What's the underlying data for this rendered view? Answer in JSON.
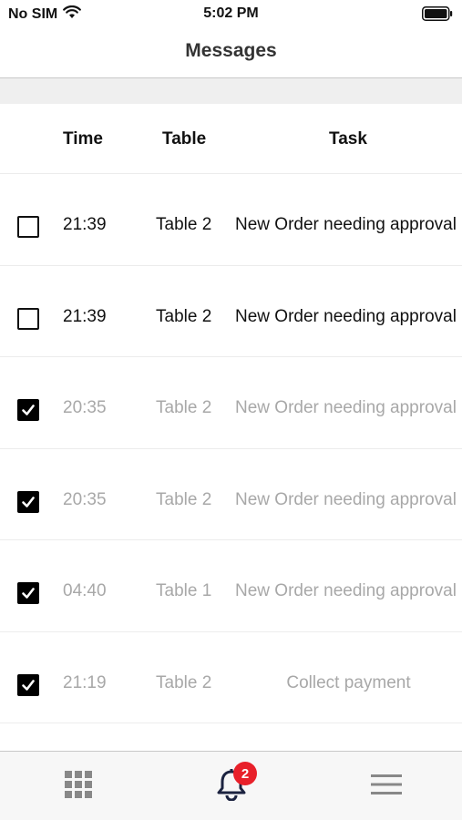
{
  "status_bar": {
    "carrier": "No SIM",
    "time": "5:02 PM"
  },
  "nav": {
    "title": "Messages"
  },
  "table": {
    "headers": {
      "time": "Time",
      "table": "Table",
      "task": "Task"
    },
    "rows": [
      {
        "checked": false,
        "time": "21:39",
        "table": "Table 2",
        "task": "New Order needing approval"
      },
      {
        "checked": false,
        "time": "21:39",
        "table": "Table 2",
        "task": "New Order needing approval"
      },
      {
        "checked": true,
        "time": "20:35",
        "table": "Table 2",
        "task": "New Order needing approval"
      },
      {
        "checked": true,
        "time": "20:35",
        "table": "Table 2",
        "task": "New Order needing approval"
      },
      {
        "checked": true,
        "time": "04:40",
        "table": "Table 1",
        "task": "New Order needing approval"
      },
      {
        "checked": true,
        "time": "21:19",
        "table": "Table 2",
        "task": "Collect payment"
      }
    ]
  },
  "tab_bar": {
    "tabs": [
      {
        "icon": "grid-icon"
      },
      {
        "icon": "bell-icon",
        "badge": "2"
      },
      {
        "icon": "hamburger-menu-icon"
      }
    ]
  },
  "colors": {
    "badge": "#e8202a",
    "done_text": "#a8a8a8",
    "tab_icon_active": "#1c2340",
    "tab_icon": "#888888"
  }
}
